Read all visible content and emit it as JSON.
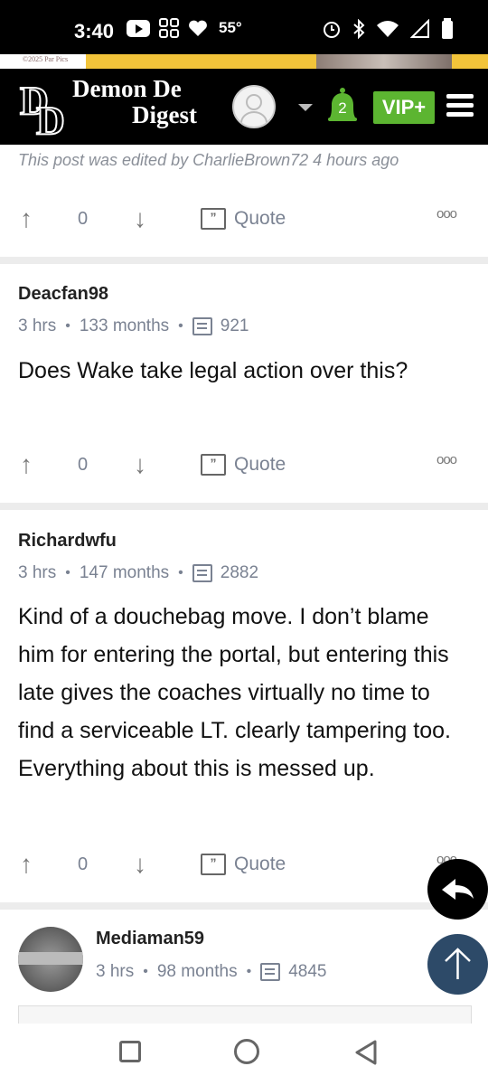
{
  "status_bar": {
    "time": "3:40",
    "temperature": "55°",
    "icons": [
      "youtube-icon",
      "grid-icon",
      "heart-icon",
      "alarm-icon",
      "bluetooth-icon",
      "wifi-icon",
      "signal-icon",
      "battery-icon"
    ]
  },
  "ad": {
    "text": "©2025 Par Pics"
  },
  "header": {
    "logo_line1": "Demon De",
    "logo_line2": "Digest",
    "logo_mark": "DD",
    "notification_count": "2",
    "vip_label": "VIP+",
    "colors": {
      "vip": "#5cb531",
      "background": "#000000"
    }
  },
  "edited_notice": "This post was edited by CharlieBrown72 4 hours ago",
  "post_actions_labels": {
    "quote": "Quote",
    "more": "ooo"
  },
  "action_rows": [
    {
      "vote_count": "0"
    },
    {
      "vote_count": "0"
    },
    {
      "vote_count": "0"
    }
  ],
  "posts": [
    {
      "author": "Deacfan98",
      "time": "3 hrs",
      "tenure": "133 months",
      "message_count": "921",
      "body": "Does Wake take legal action over this?"
    },
    {
      "author": "Richardwfu",
      "time": "3 hrs",
      "tenure": "147 months",
      "message_count": "2882",
      "body": "Kind of a douchebag move. I don’t blame him for entering the portal, but entering this late gives the coaches virtually no time to find a serviceable LT. clearly tampering too. Everything about this is messed up."
    },
    {
      "author": "Mediaman59",
      "time": "3 hrs",
      "tenure": "98 months",
      "message_count": "4845",
      "body": ""
    }
  ],
  "fab": {
    "reply_icon": "reply-arrow-icon",
    "top_icon": "arrow-up-icon",
    "top_color": "#2d4a68"
  },
  "nav": {
    "icons": [
      "recents-square-icon",
      "home-circle-icon",
      "back-triangle-icon"
    ]
  }
}
